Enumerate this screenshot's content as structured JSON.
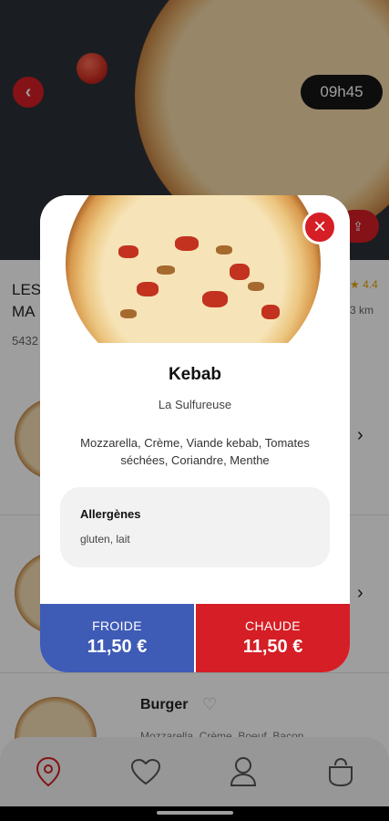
{
  "header": {
    "time": "09h45",
    "back_icon": "chevron-left-icon",
    "share_icon": "share-icon"
  },
  "restaurant": {
    "name": "LES MA",
    "address": "5432",
    "rating": "4.4",
    "distance": "3 km"
  },
  "menu": {
    "items": [
      {
        "title": "Burger",
        "desc": "Mozzarella, Crème, Boeuf, Bacon"
      }
    ]
  },
  "modal": {
    "dish_name": "Kebab",
    "restaurant": "La Sulfureuse",
    "ingredients": "Mozzarella, Crème, Viande kebab, Tomates séchées, Coriandre, Menthe",
    "allergens_title": "Allergènes",
    "allergens": "gluten, lait",
    "cold": {
      "label": "FROIDE",
      "price": "11,50 €"
    },
    "hot": {
      "label": "CHAUDE",
      "price": "11,50 €"
    },
    "close_icon": "close-icon"
  },
  "colors": {
    "accent_red": "#d51e25",
    "accent_blue": "#3e5bb6"
  },
  "tabbar": {
    "items": [
      "location-pin-icon",
      "heart-icon",
      "user-icon",
      "bag-icon"
    ]
  }
}
